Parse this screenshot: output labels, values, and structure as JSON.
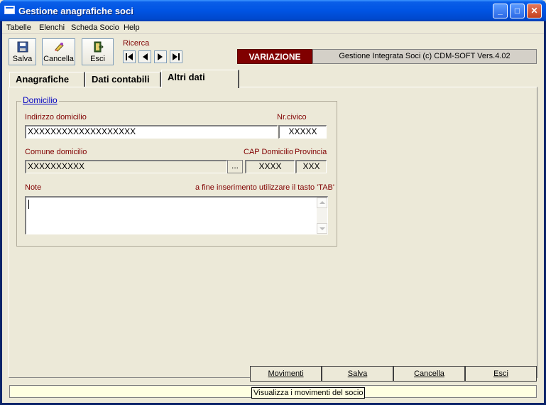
{
  "window": {
    "title": "Gestione anagrafiche soci",
    "minimize": "_",
    "maximize": "□",
    "close": "✕"
  },
  "menu": [
    "Tabelle",
    "Elenchi",
    "Scheda Socio",
    "Help"
  ],
  "toolbar": {
    "save_label": "Salva",
    "delete_label": "Cancella",
    "exit_label": "Esci"
  },
  "search": {
    "label": "Ricerca"
  },
  "mode": {
    "badge": "VARIAZIONE",
    "color": "#800000",
    "app_info": "Gestione Integrata Soci (c) CDM-SOFT Vers.4.02"
  },
  "tabs": [
    {
      "label": "Anagrafiche",
      "active": false
    },
    {
      "label": "Dati contabili",
      "active": false
    },
    {
      "label": "Altri dati",
      "active": true
    }
  ],
  "domicilio": {
    "legend": "Domicilio",
    "indirizzo_label": "Indirizzo domicilio",
    "indirizzo_value": "XXXXXXXXXXXXXXXXXXX",
    "civico_label": "Nr.civico",
    "civico_value": "XXXXX",
    "comune_label": "Comune domicilio",
    "comune_value": "XXXXXXXXXX",
    "browse_label": "...",
    "cap_label": "CAP Domicilio",
    "cap_value": "XXXX",
    "provincia_label": "Provincia",
    "provincia_value": "XXX",
    "note_label": "Note",
    "note_hint": "a fine inserimento utilizzare il tasto 'TAB'",
    "note_value": ""
  },
  "footer": {
    "movimenti": "Movimenti",
    "salva": "Salva",
    "cancella": "Cancella",
    "esci": "Esci"
  },
  "status": {
    "tooltip": "Visualizza i movimenti del socio"
  }
}
